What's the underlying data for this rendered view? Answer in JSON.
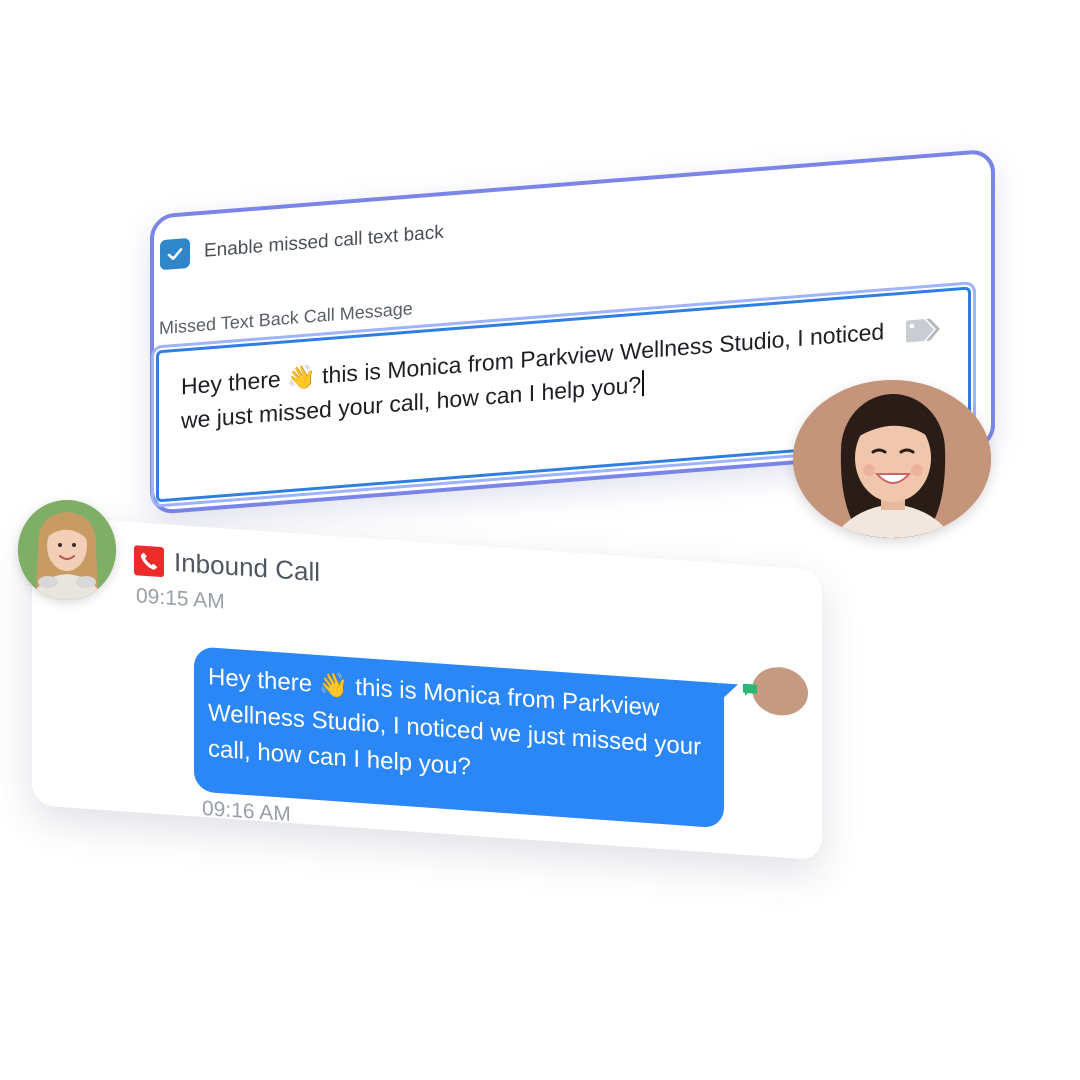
{
  "settings": {
    "enable_label": "Enable missed call text back",
    "enabled": true,
    "field_label": "Missed Text Back Call Message",
    "message_value": "Hey there 👋 this is Monica from Parkview Wellness Studio, I noticed we just missed your call, how can I help you?"
  },
  "conversation": {
    "call_title": "Inbound Call",
    "call_time": "09:15 AM",
    "bubble_text": "Hey there 👋 this is Monica from Parkview Wellness Studio, I noticed we just missed your call, how can I help you?",
    "sent_time": "09:16 AM"
  },
  "colors": {
    "card_border": "#7b85e8",
    "checkbox": "#2f86c8",
    "input_border": "#2f7fe0",
    "bubble": "#2b87f5",
    "phone_badge": "#ee2b2b",
    "time_text": "#9aa0a8"
  },
  "icons": {
    "checkbox": "check-icon",
    "tag": "tag-icon",
    "phone": "phone-icon",
    "sms": "sms-icon"
  }
}
